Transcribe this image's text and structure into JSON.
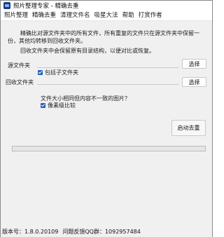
{
  "window": {
    "title": "照片整理专家 - 精确去重"
  },
  "menu": {
    "items": [
      "照片整理",
      "精确去重",
      "清理文件名",
      "吸星大法",
      "帮助",
      "打赏作者"
    ]
  },
  "main": {
    "description": "精确比对源文件夹中的所有文件，所有重复的文件只在源文件夹中保留一份，其他均转移到回收文件夹。",
    "description2": "回收文件夹中会保留原有目录结构，以便对比或恢复。",
    "source_label": "源文件夹",
    "source_select": "选择",
    "include_subfolders": "包括子文件夹",
    "include_subfolders_checked": true,
    "recycle_label": "回收文件夹",
    "recycle_select": "选择",
    "question": "文件大小相同但内容不一致的图片？",
    "pixel_compare": "像素级比较",
    "pixel_compare_checked": true,
    "start_button": "启动去重",
    "progress": 0
  },
  "statusbar": {
    "version": "版本号：1.8.0.20109",
    "qq": "问题反馈QQ群：1092957484"
  },
  "colors": {
    "accent": "#1f5fbf",
    "window_bg": "#f0f0f0",
    "progress_fill": "#06b025"
  }
}
